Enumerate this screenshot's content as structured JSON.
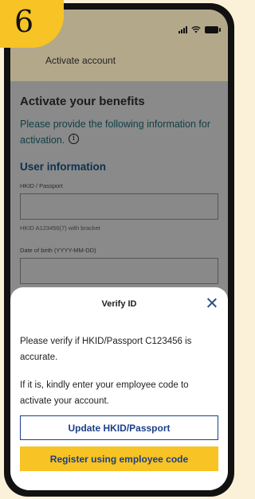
{
  "step_number": "6",
  "header": {
    "title": "Activate account"
  },
  "status_bar": {
    "icons": [
      "signal-icon",
      "wifi-icon",
      "battery-icon"
    ]
  },
  "page": {
    "heading": "Activate your benefits",
    "intro": "Please provide the following information for activation.",
    "section_title": "User information",
    "hkid_label": "HKID / Passport",
    "hkid_value": "",
    "hkid_hint": "HKID A123456(7) with bracket",
    "dob_label": "Date of birth (YYYY-MM-DD)",
    "dob_value": ""
  },
  "modal": {
    "title": "Verify ID",
    "message_1": "Please verify if HKID/Passport C123456 is accurate.",
    "message_2": "If it is, kindly enter your employee code to activate your account.",
    "update_button": "Update HKID/Passport",
    "register_button": "Register using employee code"
  },
  "colors": {
    "accent_yellow": "#f7c325",
    "primary_blue": "#1c3f87",
    "page_background": "#fbf1d8"
  }
}
